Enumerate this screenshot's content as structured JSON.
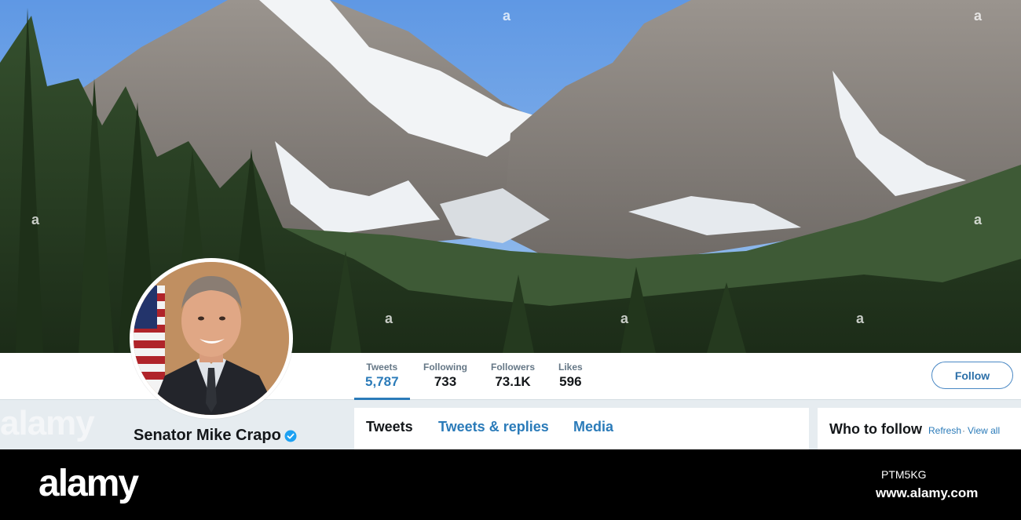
{
  "profile": {
    "name": "Senator Mike Crapo",
    "verified": true
  },
  "nav": {
    "stats": [
      {
        "label": "Tweets",
        "value": "5,787",
        "active": true
      },
      {
        "label": "Following",
        "value": "733",
        "active": false
      },
      {
        "label": "Followers",
        "value": "73.1K",
        "active": false
      },
      {
        "label": "Likes",
        "value": "596",
        "active": false
      }
    ],
    "follow_label": "Follow"
  },
  "timeline": {
    "tabs": [
      {
        "label": "Tweets",
        "active": true
      },
      {
        "label": "Tweets & replies",
        "active": false
      },
      {
        "label": "Media",
        "active": false
      }
    ]
  },
  "who_to_follow": {
    "title": "Who to follow",
    "refresh": "Refresh",
    "separator": "·",
    "view_all": "View all"
  },
  "watermark": {
    "brand": "alamy",
    "image_id": "PTM5KG",
    "url": "www.alamy.com",
    "mark": "a"
  },
  "colors": {
    "accent": "#2b7bb9",
    "verified": "#1da1f2",
    "sky": "#6aa2e8"
  },
  "icons": {
    "verified": "verified-badge-icon"
  }
}
